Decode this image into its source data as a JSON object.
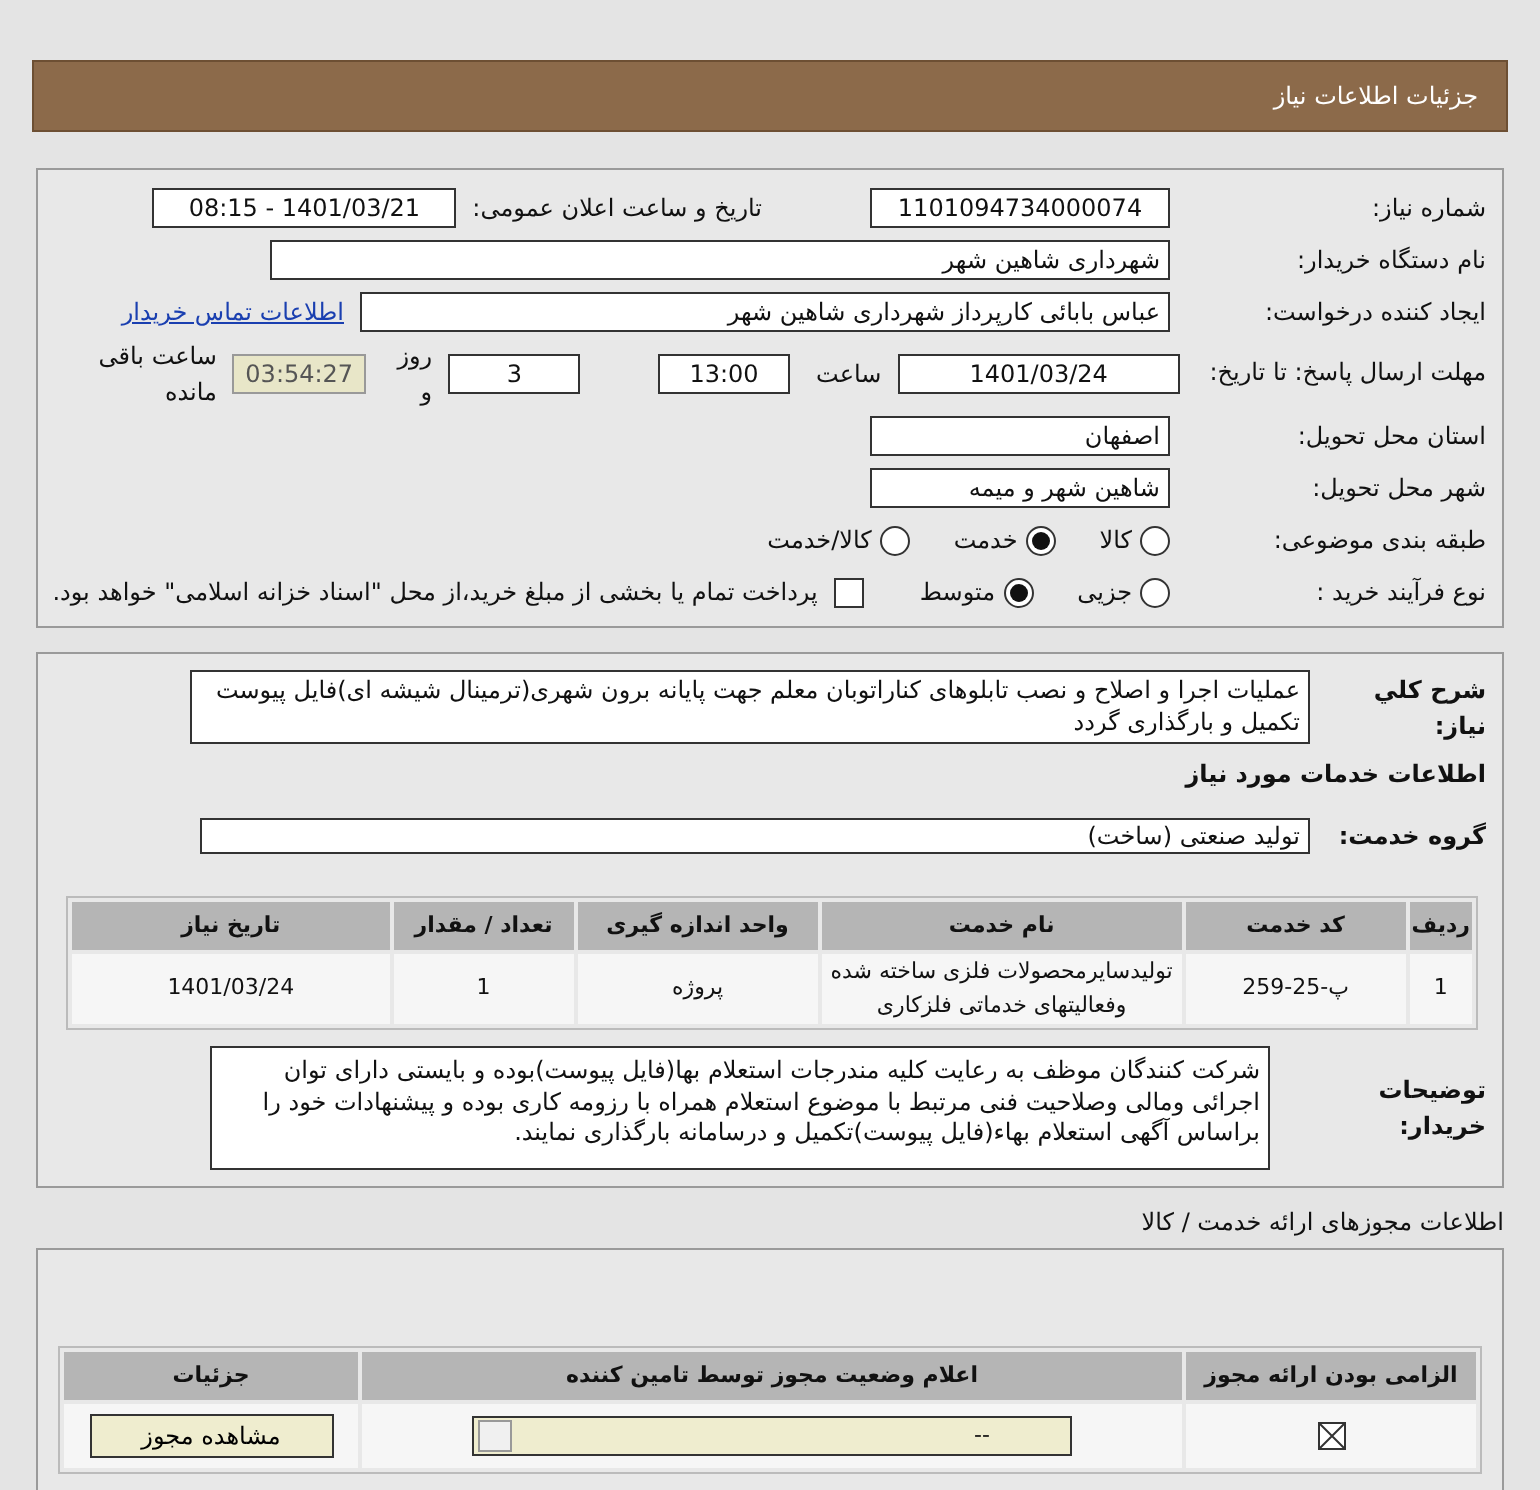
{
  "header": {
    "title": "جزئیات اطلاعات نیاز"
  },
  "details": {
    "need_number": {
      "label": "شماره نیاز:",
      "value": "1101094734000074"
    },
    "announce": {
      "label": "تاریخ و ساعت اعلان عمومی:",
      "value": "1401/03/21 - 08:15"
    },
    "buyer": {
      "label": "نام دستگاه خریدار:",
      "value": "شهرداری شاهین شهر"
    },
    "creator": {
      "label": "ایجاد کننده درخواست:",
      "value": "عباس بابائی کارپرداز شهرداری شاهین شهر",
      "link": "اطلاعات تماس خریدار"
    },
    "deadline": {
      "label": "مهلت ارسال پاسخ: تا تاریخ:",
      "date": "1401/03/24",
      "time_label": "ساعت",
      "time": "13:00",
      "days": "3",
      "days_label": "روز و",
      "remaining": "03:54:27",
      "remaining_label": "ساعت باقی مانده"
    },
    "province": {
      "label": "استان محل تحویل:",
      "value": "اصفهان"
    },
    "city": {
      "label": "شهر محل تحویل:",
      "value": "شاهین شهر و میمه"
    },
    "category": {
      "label": "طبقه بندی موضوعی:",
      "options": [
        {
          "label": "کالا",
          "selected": false
        },
        {
          "label": "خدمت",
          "selected": true
        },
        {
          "label": "کالا/خدمت",
          "selected": false
        }
      ]
    },
    "process": {
      "label": "نوع فرآیند خرید :",
      "options": [
        {
          "label": "جزیی",
          "selected": false
        },
        {
          "label": "متوسط",
          "selected": true
        }
      ],
      "treasury": {
        "checked": false,
        "text": "پرداخت تمام یا بخشی از مبلغ خرید،از محل \"اسناد خزانه اسلامی\" خواهد بود."
      }
    }
  },
  "needs": {
    "summary": {
      "label": "شرح كلي نياز:",
      "text": "عملیات اجرا و اصلاح و نصب تابلوهای کناراتوبان معلم جهت پایانه برون شهری(ترمینال شیشه ای)فایل پیوست تکمیل و بارگذاری گردد"
    },
    "services_heading": "اطلاعات خدمات مورد نیاز",
    "group": {
      "label": "گروه خدمت:",
      "value": "تولید صنعتی (ساخت)"
    },
    "table": {
      "columns": [
        "ردیف",
        "کد خدمت",
        "نام خدمت",
        "واحد اندازه گیری",
        "تعداد / مقدار",
        "تاریخ نیاز"
      ],
      "rows": [
        [
          "1",
          "پ-25-259",
          "تولیدسایرمحصولات فلزی ساخته شده وفعالیتهای خدماتی فلزکاری",
          "پروژه",
          "1",
          "1401/03/24"
        ]
      ]
    },
    "notes": {
      "label": "توضیحات خریدار:",
      "text": "شرکت کنندگان موظف به رعایت کلیه مندرجات استعلام بها(فایل پیوست)بوده و بایستی دارای توان اجرائی ومالی وصلاحیت فنی مرتبط با موضوع استعلام همراه با رزومه کاری بوده و پیشنهادات خود را براساس آگهی استعلام  بهاء(فایل پیوست)تکمیل و درسامانه بارگذاری نمایند."
    }
  },
  "permits": {
    "title": "اطلاعات مجوزهای ارائه خدمت / کالا",
    "columns": [
      "الزامی بودن ارائه مجوز",
      "اعلام وضعیت مجوز توسط تامین کننده",
      "جزئیات"
    ],
    "rows": [
      {
        "required": true,
        "status": "--",
        "button": "مشاهده مجوز"
      }
    ]
  }
}
